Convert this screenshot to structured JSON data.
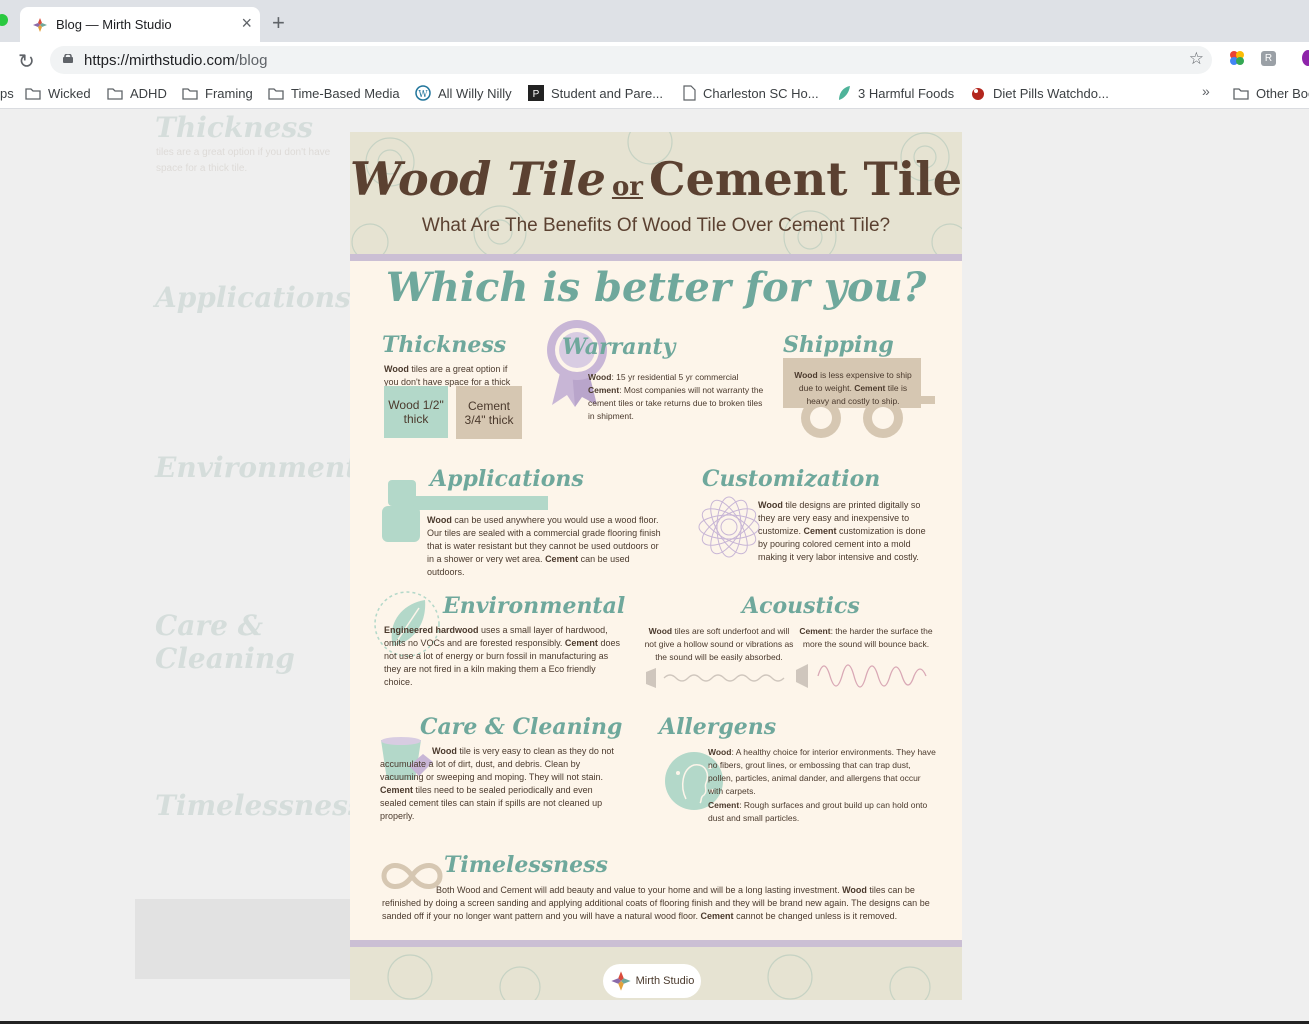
{
  "browser": {
    "tab_title": "Blog — Mirth Studio",
    "new_tab": "+",
    "tab_close": "×",
    "url_host": "https://mirthstudio.com",
    "url_path": "/blog",
    "bookmarks": [
      {
        "label": "ps",
        "icon": "none"
      },
      {
        "label": "Wicked",
        "icon": "folder-icon"
      },
      {
        "label": "ADHD",
        "icon": "folder-icon"
      },
      {
        "label": "Framing",
        "icon": "folder-icon"
      },
      {
        "label": "Time-Based Media",
        "icon": "folder-icon"
      },
      {
        "label": "All Willy Nilly",
        "icon": "wordpress-icon"
      },
      {
        "label": "Student and Pare...",
        "icon": "site-icon"
      },
      {
        "label": "Charleston SC Ho...",
        "icon": "page-icon"
      },
      {
        "label": "3 Harmful Foods",
        "icon": "leaf-icon"
      },
      {
        "label": "Diet Pills Watchdo...",
        "icon": "pill-icon"
      }
    ],
    "overflow": "»",
    "other_bookmarks": "Other Boo"
  },
  "infographic": {
    "title_a": "Wood Tile",
    "title_or": "or",
    "title_b": "Cement Tile",
    "subtitle": "What Are The Benefits Of Wood Tile Over Cement Tile?",
    "question": "Which is better for you?",
    "thickness": {
      "heading": "Thickness",
      "text_bold": "Wood",
      "text": " tiles are a great option if you don't have space for a thick tile.",
      "wood_chip": "Wood 1/2\" thick",
      "cement_chip": "Cement 3/4\" thick"
    },
    "warranty": {
      "heading": "Warranty",
      "wood_bold": "Wood",
      "wood_text": ": 15 yr residential 5 yr commercial",
      "cement_bold": "Cement",
      "cement_text": ": Most companies will not warranty the cement tiles or take returns due to broken tiles in shipment."
    },
    "shipping": {
      "heading": "Shipping",
      "wood_bold": "Wood",
      "text1": " is less expensive to ship due to weight. ",
      "cement_bold": "Cement",
      "text2": " tile is heavy and costly to ship."
    },
    "applications": {
      "heading": "Applications",
      "wood_bold": "Wood",
      "text1": " can be used anywhere you would use a wood floor. Our tiles are sealed with a commercial grade flooring finish that is water resistant but they cannot be used outdoors or in a shower or very wet area. ",
      "cement_bold": "Cement",
      "text2": " can be used outdoors."
    },
    "customization": {
      "heading": "Customization",
      "wood_bold": "Wood",
      "text1": " tile designs are printed digitally so they are very easy and inexpensive to customize. ",
      "cement_bold": "Cement",
      "text2": " customization is done by pouring colored cement into a mold making it very labor intensive and costly."
    },
    "environmental": {
      "heading": "Environmental",
      "eng_bold": "Engineered hardwood",
      "text1": " uses a small layer of hardwood, omits no VOCs and are forested responsibly. ",
      "cement_bold": "Cement",
      "text2": " does not use a lot of energy or burn fossil in manufacturing as they are not fired in a kiln making them a Eco friendly choice."
    },
    "acoustics": {
      "heading": "Acoustics",
      "wood_bold": "Wood",
      "wood_text": " tiles are soft underfoot and will not give a hollow sound or vibrations as the sound will be easily absorbed.",
      "cement_bold": "Cement",
      "cement_text": ": the harder the surface the more the sound will bounce back."
    },
    "care": {
      "heading": "Care & Cleaning",
      "wood_bold": "Wood",
      "text1": " tile is very easy to clean as they do not accumulate a lot of dirt, dust, and debris. Clean by vacuuming or sweeping and moping. They will not stain. ",
      "cement_bold": "Cement",
      "text2": " tiles need to be sealed periodically and even sealed cement tiles can stain if spills are not cleaned up properly."
    },
    "allergens": {
      "heading": "Allergens",
      "wood_bold": "Wood",
      "wood_text": ": A healthy choice for interior environments. They have no fibers, grout lines, or embossing that can trap dust, pollen, particles, animal dander, and allergens that occur with carpets.",
      "cement_bold": "Cement",
      "cement_text": ": Rough surfaces and grout build up can hold onto dust and small particles."
    },
    "timelessness": {
      "heading": "Timelessness",
      "text1": "Both Wood and Cement will add beauty and value to your home and will be a long lasting investment. ",
      "wood_bold": "Wood",
      "text2": " tiles can be refinished by doing a screen sanding and applying additional coats of flooring finish and they will be brand new again. The designs can be sanded off if your no longer want pattern and you will have a natural wood floor. ",
      "cement_bold": "Cement",
      "text3": " cannot be changed unless is it removed."
    },
    "footer_logo": "Mirth Studio"
  },
  "colors": {
    "teal": "#6fa89c",
    "brown": "#5b4131",
    "lavender": "#cbbfd4",
    "cream": "#fdf5ea"
  }
}
